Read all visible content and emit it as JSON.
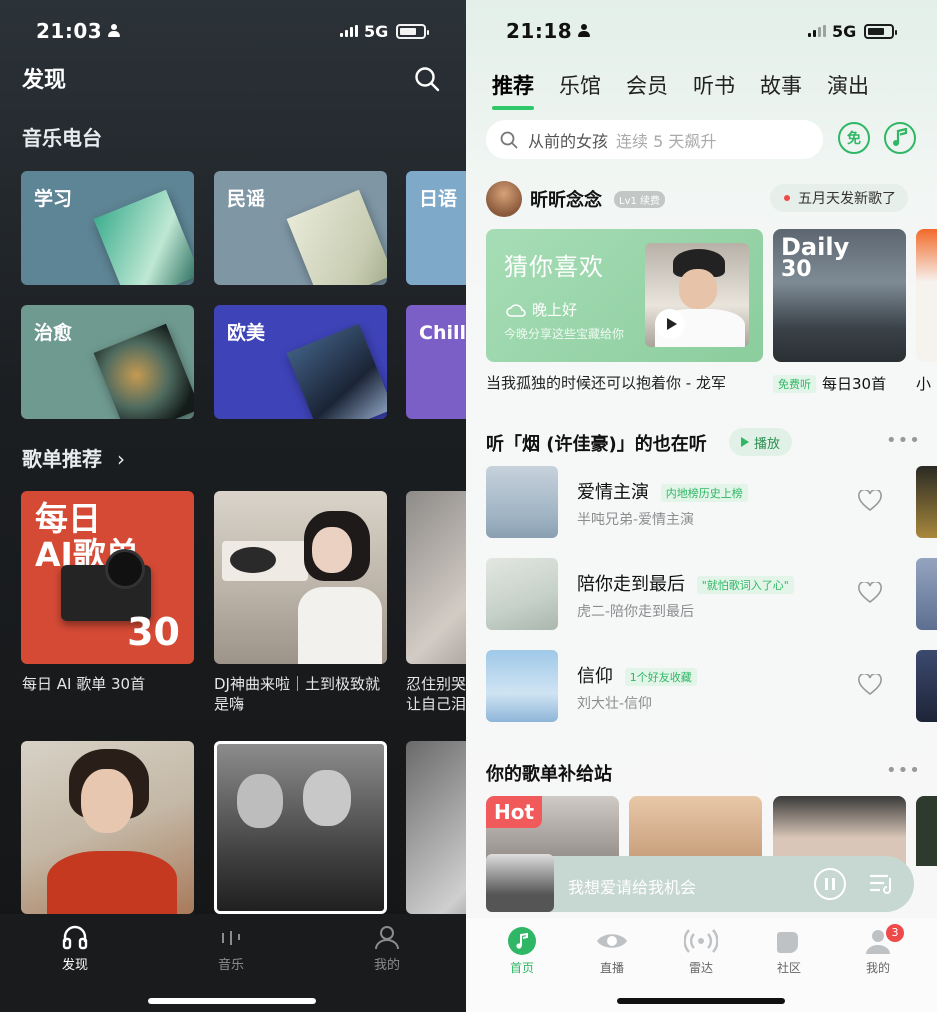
{
  "left": {
    "status": {
      "time": "21:03",
      "network": "5G"
    },
    "title": "发现",
    "radio_section": "音乐电台",
    "radio_cards": [
      "学习",
      "民谣",
      "日语",
      "治愈",
      "欧美",
      "Chill 放"
    ],
    "playlist_section": "歌单推荐",
    "playlist_more": "›",
    "cover_ai": {
      "line1": "每日",
      "line2": "AI歌单",
      "num": "30"
    },
    "playlists": [
      {
        "caption": "每日 AI 歌单 30首"
      },
      {
        "caption": "DJ神曲来啦｜土到极致就是嗨"
      },
      {
        "caption": "忍住别哭让自己泪"
      }
    ],
    "nav": [
      {
        "label": "发现",
        "icon": "headphones-icon"
      },
      {
        "label": "音乐",
        "icon": "equalizer-icon"
      },
      {
        "label": "我的",
        "icon": "person-icon"
      }
    ]
  },
  "right": {
    "status": {
      "time": "21:18",
      "network": "5G"
    },
    "tabs": [
      "推荐",
      "乐馆",
      "会员",
      "听书",
      "故事",
      "演出"
    ],
    "search": {
      "query": "从前的女孩",
      "hint": "连续 5 天飙升"
    },
    "free_badge": "免",
    "user": {
      "name": "昕昕念念",
      "level": "Lv1 续费"
    },
    "announce": "五月天发新歌了",
    "guess": {
      "title": "猜你喜欢",
      "greeting": "晚上好",
      "desc": "今晚分享这些宝藏给你",
      "caption": "当我孤独的时候还可以抱着你 - 龙军"
    },
    "daily": {
      "title": "Daily",
      "num": "30",
      "tag": "免费听",
      "caption": "每日30首"
    },
    "third_caption": "小",
    "listen_section": {
      "title": "听「烟 (许佳豪)」的也在听",
      "play": "播放"
    },
    "songs": [
      {
        "title": "爱情主演",
        "tag": "内地榜历史上榜",
        "sub": "半吨兄弟-爱情主演"
      },
      {
        "title": "陪你走到最后",
        "tag": "\"就怕歌词入了心\"",
        "sub": "虎二-陪你走到最后"
      },
      {
        "title": "信仰",
        "tag": "1个好友收藏",
        "sub": "刘大壮-信仰"
      }
    ],
    "supply_section": "你的歌单补给站",
    "hot_label": "Hot",
    "now_playing": "我想爱请给我机会",
    "nav": [
      {
        "label": "首页",
        "icon": "music-note-icon"
      },
      {
        "label": "直播",
        "icon": "eye-icon"
      },
      {
        "label": "雷达",
        "icon": "radar-icon"
      },
      {
        "label": "社区",
        "icon": "community-icon"
      },
      {
        "label": "我的",
        "icon": "person-icon",
        "badge": "3"
      }
    ],
    "colors": {
      "accent": "#2fb765"
    }
  }
}
